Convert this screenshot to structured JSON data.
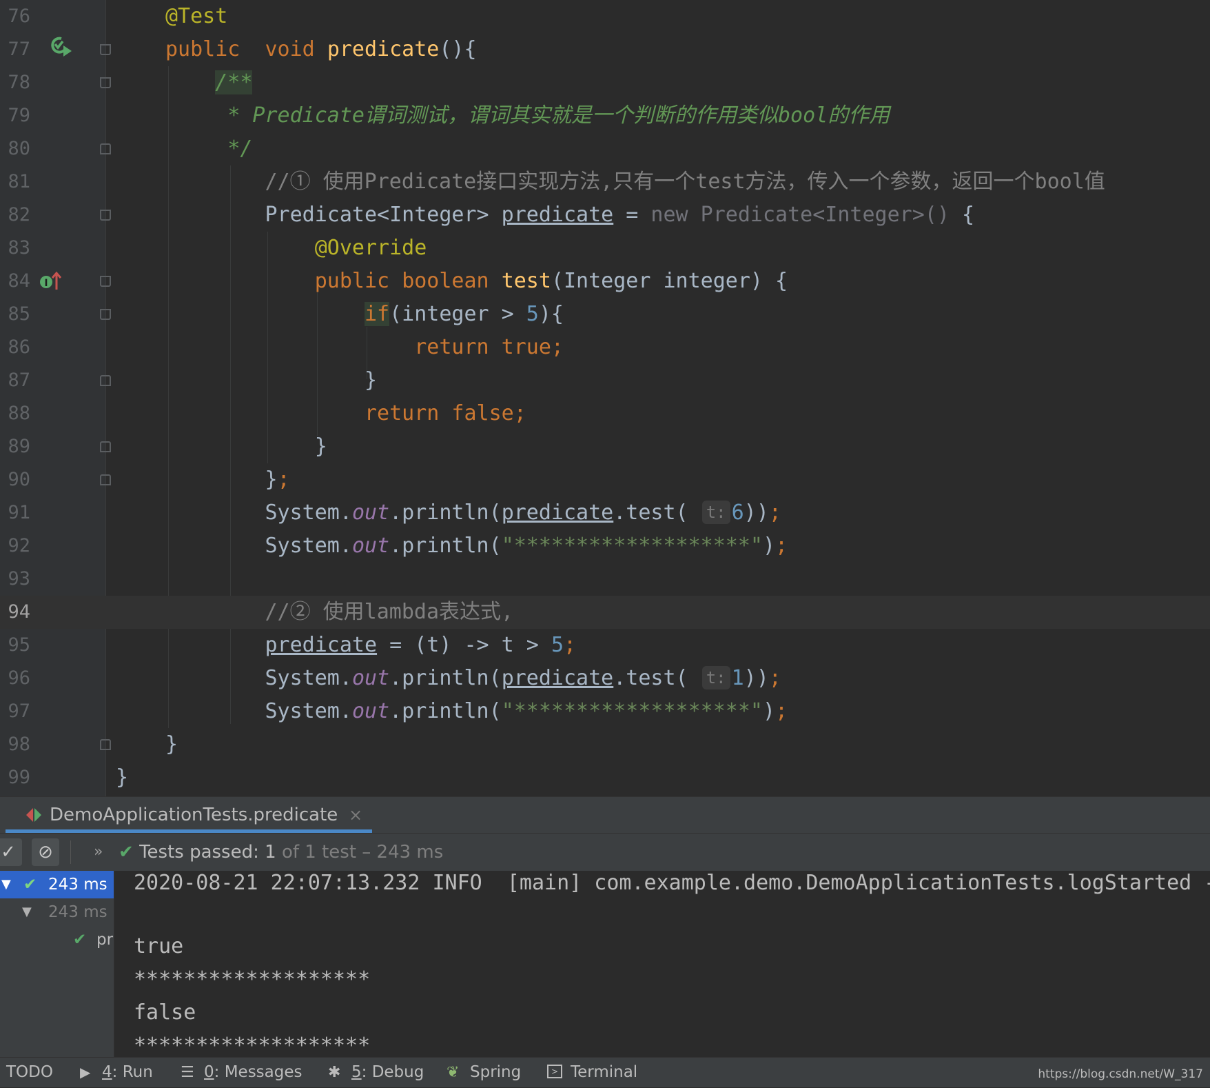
{
  "editor": {
    "lines": [
      {
        "n": "76"
      },
      {
        "n": "77"
      },
      {
        "n": "78"
      },
      {
        "n": "79"
      },
      {
        "n": "80"
      },
      {
        "n": "81"
      },
      {
        "n": "82"
      },
      {
        "n": "83"
      },
      {
        "n": "84"
      },
      {
        "n": "85"
      },
      {
        "n": "86"
      },
      {
        "n": "87"
      },
      {
        "n": "88"
      },
      {
        "n": "89"
      },
      {
        "n": "90"
      },
      {
        "n": "91"
      },
      {
        "n": "92"
      },
      {
        "n": "93"
      },
      {
        "n": "94"
      },
      {
        "n": "95"
      },
      {
        "n": "96"
      },
      {
        "n": "97"
      },
      {
        "n": "98"
      },
      {
        "n": "99"
      }
    ],
    "current_line": "94",
    "gutter_icons": {
      "run_test": "run-test-icon",
      "implements": "implements-method-icon"
    },
    "tokens": {
      "annotation_test": "@Test",
      "kw_public": "public",
      "kw_void": "void",
      "method_predicate": "predicate",
      "paren_brace": "(){",
      "doc_open": "/**",
      "doc_line": "* Predicate谓词测试，谓词其实就是一个判断的作用类似bool的作用",
      "doc_close": "*/",
      "comment_1": "//① 使用Predicate接口实现方法,只有一个test方法，传入一个参数，返回一个bool值",
      "type_predicate_integer": "Predicate<Integer>",
      "var_predicate": "predicate",
      "assign": " = ",
      "kw_new": "new",
      "anon_type": "Predicate<Integer>()",
      "open_brace": "{",
      "annotation_override": "@Override",
      "kw_boolean": "boolean",
      "method_test": "test",
      "test_params": "(Integer integer) {",
      "kw_if": "if",
      "if_cond": "(integer > ",
      "num_5": "5",
      "if_close": "){",
      "kw_return": "return",
      "kw_true": "true;",
      "close_brace": "}",
      "kw_false": "false;",
      "close_anon": "}",
      "semicolon": ";",
      "system": "System.",
      "out": "out",
      "println_open": ".println(",
      "test_call": ".test(",
      "hint_t": "t:",
      "num_6": "6",
      "close_call": "))",
      "stars_string": "\"*******************\"",
      "close_paren": ")",
      "comment_2": "//② 使用lambda表达式,",
      "lambda": " = (t) -> t > ",
      "num_1": "1"
    }
  },
  "run_panel": {
    "tab_label": "DemoApplicationTests.predicate",
    "tab_close": "×",
    "toolbar": {
      "show_passed": "✓",
      "show_ignored": "⊘",
      "more": "»"
    },
    "status_passed": "Tests passed: ",
    "status_count": "1",
    "status_rest": " of 1 test – 243 ms",
    "tree": [
      {
        "label": "243 ms"
      },
      {
        "label": "243 ms"
      },
      {
        "label": "pr"
      }
    ],
    "console": [
      "2020-08-21 22:07:13.232 INFO  [main] com.example.demo.DemoApplicationTests.logStarted -",
      "true",
      "*******************",
      "false",
      "*******************"
    ]
  },
  "bottom_bar": {
    "todo": "TODO",
    "run_key": "4",
    "run_label": ": Run",
    "messages_key": "0",
    "messages_label": ": Messages",
    "debug_key": "5",
    "debug_label": ": Debug",
    "spring": "Spring",
    "terminal": "Terminal",
    "watermark": "https://blog.csdn.net/W_317"
  }
}
